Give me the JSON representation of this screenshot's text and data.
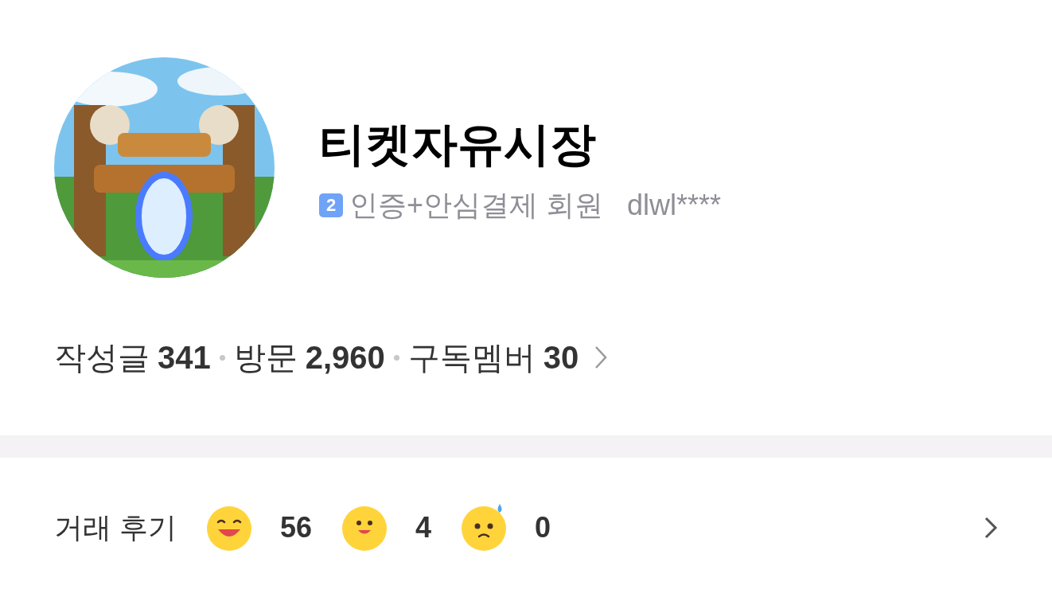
{
  "profile": {
    "name": "티켓자유시장",
    "level_badge": "2",
    "member_type": "인증+안심결제 회원",
    "user_id": "dlwl****"
  },
  "stats": [
    {
      "label": "작성글",
      "value": "341"
    },
    {
      "label": "방문",
      "value": "2,960"
    },
    {
      "label": "구독멤버",
      "value": "30"
    }
  ],
  "reviews": {
    "label": "거래 후기",
    "items": [
      {
        "kind": "great",
        "count": "56"
      },
      {
        "kind": "good",
        "count": "4"
      },
      {
        "kind": "bad",
        "count": "0"
      }
    ]
  }
}
